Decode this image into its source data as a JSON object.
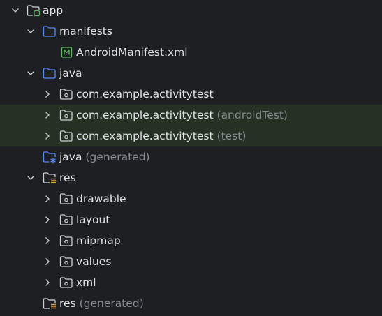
{
  "tree": {
    "app": {
      "label": "app",
      "icon": "android-module-folder-icon"
    },
    "manifests": {
      "label": "manifests",
      "icon": "folder-icon"
    },
    "android_manifest": {
      "label": "AndroidManifest.xml",
      "icon": "manifest-file-icon",
      "icon_letter": "M"
    },
    "java": {
      "label": "java",
      "icon": "source-folder-icon"
    },
    "pkg_main": {
      "label": "com.example.activitytest",
      "suffix": "",
      "icon": "package-icon"
    },
    "pkg_android_test": {
      "label": "com.example.activitytest",
      "suffix": "(androidTest)",
      "icon": "package-icon"
    },
    "pkg_test": {
      "label": "com.example.activitytest",
      "suffix": "(test)",
      "icon": "package-icon"
    },
    "java_generated": {
      "label": "java",
      "suffix": "(generated)",
      "icon": "generated-source-folder-icon"
    },
    "res": {
      "label": "res",
      "icon": "resource-folder-icon"
    },
    "drawable": {
      "label": "drawable",
      "icon": "package-icon"
    },
    "layout": {
      "label": "layout",
      "icon": "package-icon"
    },
    "mipmap": {
      "label": "mipmap",
      "icon": "package-icon"
    },
    "values": {
      "label": "values",
      "icon": "package-icon"
    },
    "xml": {
      "label": "xml",
      "icon": "package-icon"
    },
    "res_generated": {
      "label": "res",
      "suffix": "(generated)",
      "icon": "resource-folder-icon"
    }
  },
  "colors": {
    "background": "#1e1f22",
    "text": "#dfe1e5",
    "suffix_text": "#868a91",
    "folder_blue": "#548af7",
    "package_gray": "#ced0d6",
    "android_green": "#5fb865",
    "test_row_bg": "#253223",
    "resource_yellow": "#d9a343"
  }
}
